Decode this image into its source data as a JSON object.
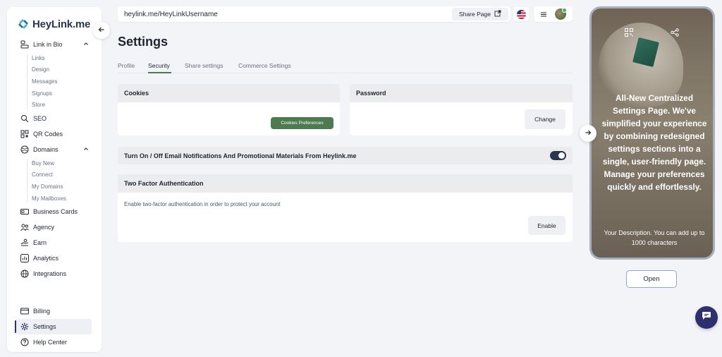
{
  "brand": {
    "name": "HeyLink.me",
    "accent": "#2d2f6e",
    "green": "#4e7a4f"
  },
  "sidebar": {
    "items": [
      {
        "label": "Link in Bio",
        "icon": "bio-icon",
        "expanded": true,
        "children": [
          "Links",
          "Design",
          "Messages",
          "Signups",
          "Store"
        ]
      },
      {
        "label": "SEO",
        "icon": "seo-icon"
      },
      {
        "label": "QR Codes",
        "icon": "qr-icon"
      },
      {
        "label": "Domains",
        "icon": "globe-icon",
        "expanded": true,
        "children": [
          "Buy New",
          "Connect",
          "My Domains",
          "My Mailboxes"
        ]
      },
      {
        "label": "Business Cards",
        "icon": "card-icon"
      },
      {
        "label": "Agency",
        "icon": "agency-icon"
      },
      {
        "label": "Earn",
        "icon": "earn-icon"
      },
      {
        "label": "Analytics",
        "icon": "analytics-icon"
      },
      {
        "label": "Integrations",
        "icon": "globe-icon"
      }
    ],
    "bottom": [
      {
        "label": "Billing",
        "icon": "billing-icon"
      },
      {
        "label": "Settings",
        "icon": "gear-icon",
        "active": true
      },
      {
        "label": "Help Center",
        "icon": "help-icon"
      }
    ]
  },
  "topbar": {
    "url": "heylink.me/HeyLinkUsername",
    "share_label": "Share Page"
  },
  "main": {
    "title": "Settings",
    "tabs": [
      {
        "label": "Profile"
      },
      {
        "label": "Security",
        "active": true
      },
      {
        "label": "Share settings"
      },
      {
        "label": "Commerce Settings"
      }
    ],
    "cookies": {
      "title": "Cookies",
      "button": "Cookies Preferences"
    },
    "password": {
      "title": "Password",
      "button": "Change"
    },
    "notifications": {
      "label": "Turn On / Off Email Notifications And Promotional Materials From Heylink.me",
      "enabled": true
    },
    "two_factor": {
      "title": "Two Factor Authentication",
      "description": "Enable two-factor authentication in order to protect your account",
      "button": "Enable"
    }
  },
  "preview": {
    "title": "All-New Centralized Settings Page. We've simplified your experience by combining redesigned settings sections into a single, user-friendly page. Manage your preferences quickly and effortlessly.",
    "description": "Your Description. You can add up to 1000 characters",
    "open_label": "Open"
  }
}
